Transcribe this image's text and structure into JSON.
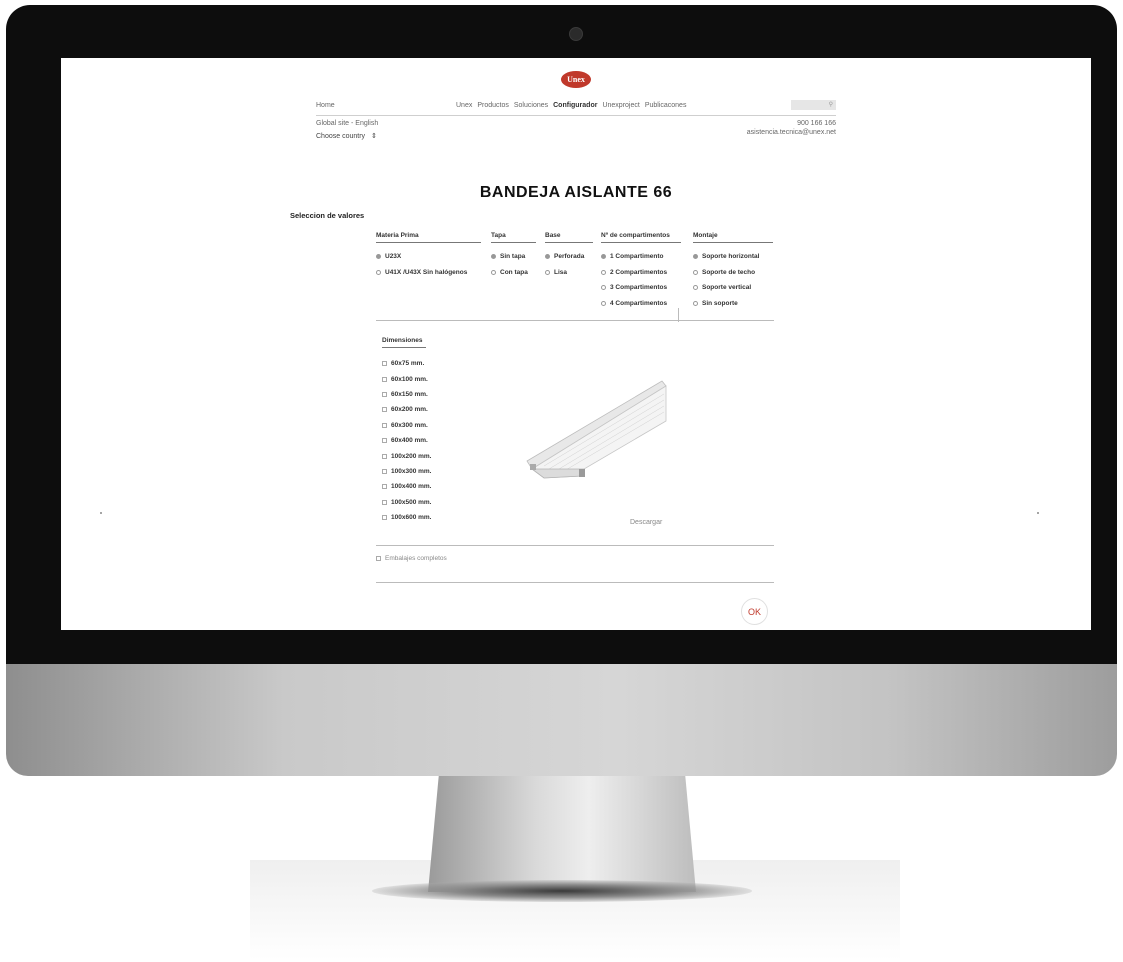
{
  "brand": {
    "logo_text": "Unex",
    "accent": "#c0392b"
  },
  "header": {
    "home": "Home",
    "nav": [
      "Unex",
      "Productos",
      "Soluciones",
      "Configurador",
      "Unexproject",
      "Publicacones"
    ],
    "active_nav": "Configurador",
    "global_site": "Global site - English",
    "country_select": "Choose country",
    "phone": "900 166 166",
    "email": "asistencia.tecnica@unex.net",
    "search_icon": "search-icon"
  },
  "page": {
    "title": "BANDEJA AISLANTE 66",
    "section_label": "Seleccion de valores"
  },
  "columns": [
    {
      "heading": "Materia Prima",
      "options": [
        {
          "label": "U23X",
          "selected": true
        },
        {
          "label": "U41X /U43X Sin halógenos",
          "selected": false
        }
      ]
    },
    {
      "heading": "Tapa",
      "options": [
        {
          "label": "Sin tapa",
          "selected": true
        },
        {
          "label": "Con tapa",
          "selected": false
        }
      ]
    },
    {
      "heading": "Base",
      "options": [
        {
          "label": "Perforada",
          "selected": true
        },
        {
          "label": "Lisa",
          "selected": false
        }
      ]
    },
    {
      "heading": "Nº de compartimentos",
      "options": [
        {
          "label": "1 Compartimento",
          "selected": true
        },
        {
          "label": "2 Compartimentos",
          "selected": false
        },
        {
          "label": "3 Compartimentos",
          "selected": false
        },
        {
          "label": "4 Compartimentos",
          "selected": false
        }
      ]
    },
    {
      "heading": "Montaje",
      "options": [
        {
          "label": "Soporte horizontal",
          "selected": true
        },
        {
          "label": "Soporte de techo",
          "selected": false
        },
        {
          "label": "Soporte vertical",
          "selected": false
        },
        {
          "label": "Sin soporte",
          "selected": false
        }
      ]
    }
  ],
  "dimensions": {
    "heading": "Dimensiones",
    "items": [
      "60x75 mm.",
      "60x100 mm.",
      "60x150 mm.",
      "60x200 mm.",
      "60x300 mm.",
      "60x400 mm.",
      "100x200 mm.",
      "100x300 mm.",
      "100x400 mm.",
      "100x500 mm.",
      "100x600 mm."
    ]
  },
  "download_label": "Descargar",
  "packaging_label": "Embalajes completos",
  "ok_label": "OK"
}
